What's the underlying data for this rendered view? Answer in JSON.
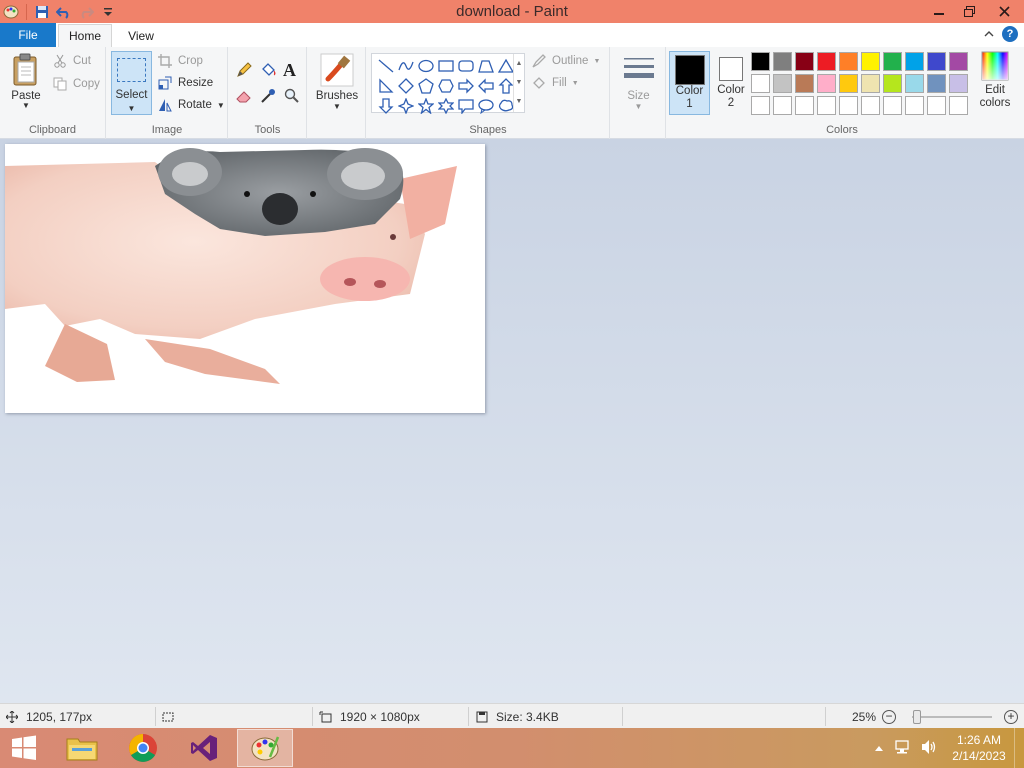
{
  "window": {
    "title": "download - Paint"
  },
  "tabs": {
    "file": "File",
    "home": "Home",
    "view": "View"
  },
  "clipboard": {
    "paste": "Paste",
    "cut": "Cut",
    "copy": "Copy",
    "group": "Clipboard"
  },
  "image": {
    "select": "Select",
    "crop": "Crop",
    "resize": "Resize",
    "rotate": "Rotate",
    "group": "Image"
  },
  "tools": {
    "group": "Tools"
  },
  "brushes": {
    "label": "Brushes"
  },
  "shapes": {
    "outline": "Outline",
    "fill": "Fill",
    "group": "Shapes"
  },
  "size": {
    "label": "Size"
  },
  "colors": {
    "color1_label": "Color",
    "color1_num": "1",
    "color2_label": "Color",
    "color2_num": "2",
    "edit_label": "Edit",
    "edit_label2": "colors",
    "group": "Colors",
    "color1": "#000000",
    "color2": "#ffffff",
    "palette": [
      "#000000",
      "#7f7f7f",
      "#880015",
      "#ed1c24",
      "#ff7f27",
      "#fff200",
      "#22b14c",
      "#00a2e8",
      "#3f48cc",
      "#a349a4",
      "#ffffff",
      "#c3c3c3",
      "#b97a57",
      "#ffaec9",
      "#ffc90e",
      "#efe4b0",
      "#b5e61d",
      "#99d9ea",
      "#7092be",
      "#c8bfe7",
      "#ffffff",
      "#ffffff",
      "#ffffff",
      "#ffffff",
      "#ffffff",
      "#ffffff",
      "#ffffff",
      "#ffffff",
      "#ffffff",
      "#ffffff"
    ]
  },
  "status": {
    "cursor": "1205, 177px",
    "dimensions": "1920 × 1080px",
    "size": "Size: 3.4KB",
    "zoom": "25%",
    "zoom_level": 0.25
  },
  "taskbar": {
    "time": "1:26 AM",
    "date": "2/14/2023"
  }
}
